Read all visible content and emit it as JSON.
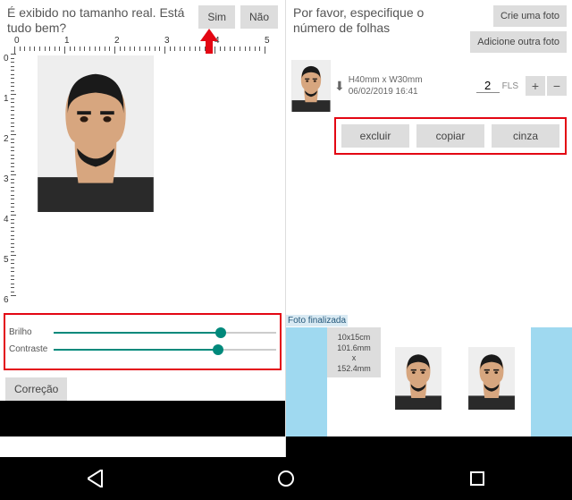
{
  "left": {
    "header_text": "É exibido no tamanho real. Está tudo bem?",
    "yes": "Sim",
    "no": "Não",
    "ruler_h": [
      "0",
      "1",
      "2",
      "3",
      "4",
      "5"
    ],
    "ruler_v": [
      "0",
      "1",
      "2",
      "3",
      "4",
      "5",
      "6"
    ],
    "brilho_label": "Brilho",
    "contraste_label": "Contraste",
    "brilho_value": 75,
    "contraste_value": 74,
    "correcao": "Correção"
  },
  "right": {
    "header_text": "Por favor, especifique o número de folhas",
    "crie": "Crie uma foto",
    "adicione": "Adicione outra foto",
    "meta_size": "H40mm x W30mm",
    "meta_date": "06/02/2019 16:41",
    "qty": "2",
    "fls": "FLS",
    "excluir": "excluir",
    "copiar": "copiar",
    "cinza": "cinza",
    "finalizada": "Foto finalizada",
    "size_1": "10x15cm",
    "size_2": "101.6mm",
    "size_3": "x",
    "size_4": "152.4mm"
  }
}
